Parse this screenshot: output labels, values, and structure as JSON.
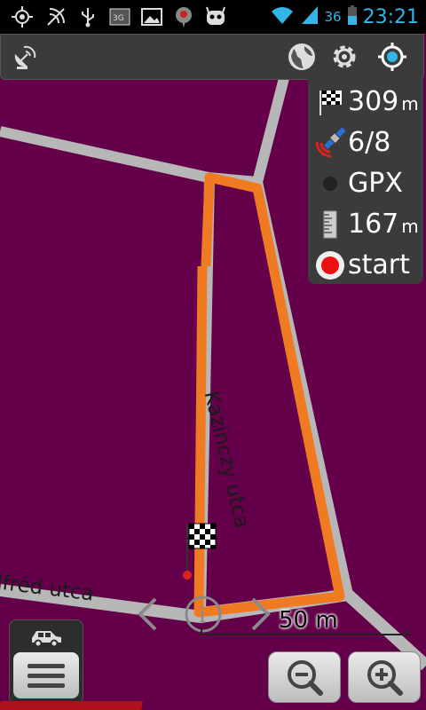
{
  "status_bar": {
    "icons": [
      "gps-icon",
      "signal-broadcast-icon",
      "usb-icon",
      "3g-icon",
      "gallery-icon",
      "map-pin-icon",
      "cyanogen-icon"
    ],
    "battery_level": "36",
    "time": "23:21"
  },
  "toolbar": {
    "left_icon": "satellite-dish-icon",
    "right_icons": [
      "globe-icon",
      "gear-icon",
      "gps-target-icon"
    ]
  },
  "info_panel": {
    "distance": {
      "value": "309",
      "unit": "m"
    },
    "satellites": {
      "value": "6/8"
    },
    "gpx": {
      "value": "GPX"
    },
    "track_length": {
      "value": "167",
      "unit": "m"
    },
    "record": {
      "value": "start"
    }
  },
  "map": {
    "streets": [
      {
        "name": "Kazinczy utca"
      },
      {
        "name": "lfréd utca"
      }
    ],
    "scale": "50 m",
    "colors": {
      "background": "#64004a",
      "road": "#b7b7b7",
      "track": "#f07a22"
    }
  },
  "controls": {
    "menu_icon": "menu-icon",
    "vehicle_icon": "car-icon",
    "zoom_out_icon": "zoom-out-icon",
    "zoom_in_icon": "zoom-in-icon"
  }
}
